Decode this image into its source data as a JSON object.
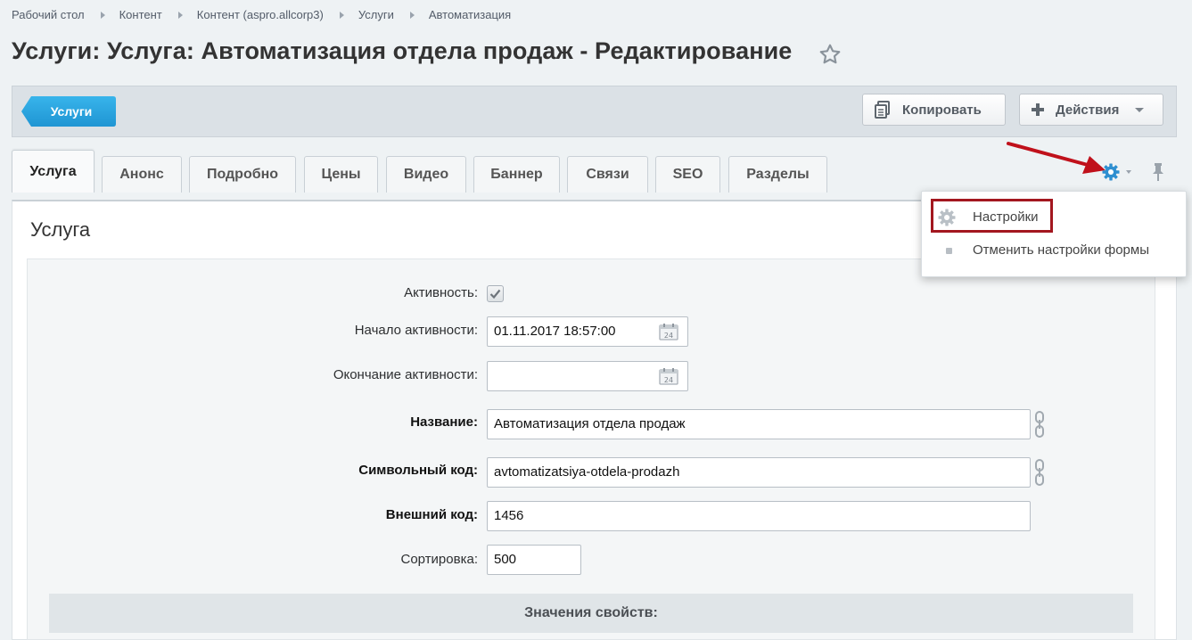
{
  "breadcrumb": {
    "items": [
      "Рабочий стол",
      "Контент",
      "Контент (aspro.allcorp3)",
      "Услуги",
      "Автоматизация"
    ]
  },
  "page": {
    "title": "Услуги: Услуга: Автоматизация отдела продаж - Редактирование"
  },
  "toolbar": {
    "back_label": "Услуги",
    "copy_label": "Копировать",
    "actions_label": "Действия"
  },
  "tabs": [
    {
      "label": "Услуга",
      "active": true
    },
    {
      "label": "Анонс"
    },
    {
      "label": "Подробно"
    },
    {
      "label": "Цены"
    },
    {
      "label": "Видео"
    },
    {
      "label": "Баннер"
    },
    {
      "label": "Связи"
    },
    {
      "label": "SEO"
    },
    {
      "label": "Разделы"
    }
  ],
  "section": {
    "title": "Услуга"
  },
  "form": {
    "active_label": "Активность:",
    "active_checked": true,
    "start_label": "Начало активности:",
    "start_value": "01.11.2017 18:57:00",
    "end_label": "Окончание активности:",
    "end_value": "",
    "name_label": "Название:",
    "name_value": "Автоматизация отдела продаж",
    "code_label": "Символьный код:",
    "code_value": "avtomatizatsiya-otdela-prodazh",
    "ext_code_label": "Внешний код:",
    "ext_code_value": "1456",
    "sort_label": "Сортировка:",
    "sort_value": "500"
  },
  "properties": {
    "header": "Значения свойств:"
  },
  "settings_menu": {
    "settings_label": "Настройки",
    "reset_label": "Отменить настройки формы"
  },
  "colors": {
    "accent_blue": "#2fa7e0",
    "highlight_red": "#a3171f",
    "arrow_red": "#c0111b"
  },
  "icons": [
    "star-icon",
    "copy-icon",
    "plus-icon",
    "chevron-down-icon",
    "gear-icon",
    "pin-icon",
    "calendar-icon",
    "link-icon",
    "check-icon"
  ]
}
